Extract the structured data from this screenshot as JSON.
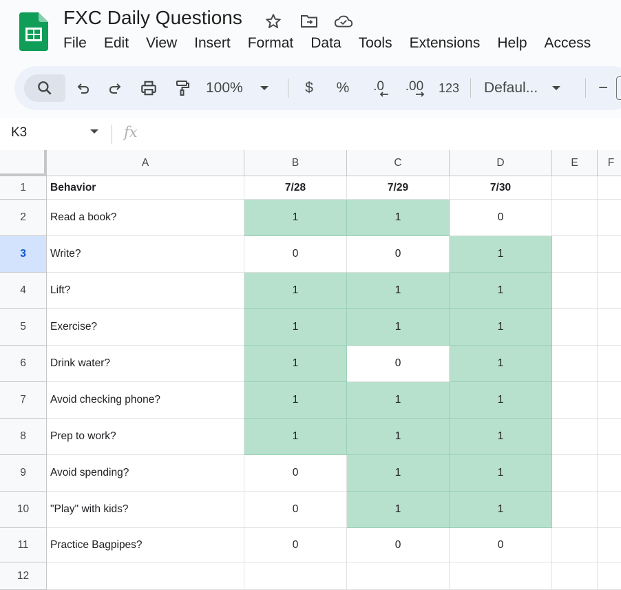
{
  "doc": {
    "title": "FXC Daily Questions",
    "icons": [
      "star-icon",
      "move-folder-icon",
      "cloud-saved-icon"
    ]
  },
  "menu": [
    "File",
    "Edit",
    "View",
    "Insert",
    "Format",
    "Data",
    "Tools",
    "Extensions",
    "Help",
    "Access"
  ],
  "toolbar": {
    "zoom": "100%",
    "currency": "$",
    "percent": "%",
    "dec_decrease": ".0",
    "dec_increase": ".00",
    "number_format": "123",
    "font": "Defaul...",
    "minus": "−"
  },
  "formula_bar": {
    "cell_ref": "K3",
    "fx": "fx"
  },
  "sheet": {
    "columns": [
      "A",
      "B",
      "C",
      "D",
      "E",
      "F"
    ],
    "rows": [
      "1",
      "2",
      "3",
      "4",
      "5",
      "6",
      "7",
      "8",
      "9",
      "10",
      "11",
      "12"
    ],
    "selected_row": "3",
    "header": [
      "Behavior",
      "7/28",
      "7/29",
      "7/30"
    ],
    "data": [
      {
        "label": "Read a book?",
        "values": [
          "1",
          "1",
          "0"
        ]
      },
      {
        "label": "Write?",
        "values": [
          "0",
          "0",
          "1"
        ]
      },
      {
        "label": "Lift?",
        "values": [
          "1",
          "1",
          "1"
        ]
      },
      {
        "label": "Exercise?",
        "values": [
          "1",
          "1",
          "1"
        ]
      },
      {
        "label": "Drink water?",
        "values": [
          "1",
          "0",
          "1"
        ]
      },
      {
        "label": "Avoid checking phone?",
        "values": [
          "1",
          "1",
          "1"
        ]
      },
      {
        "label": "Prep to work?",
        "values": [
          "1",
          "1",
          "1"
        ]
      },
      {
        "label": "Avoid spending?",
        "values": [
          "0",
          "1",
          "1"
        ]
      },
      {
        "label": "\"Play\" with kids?",
        "values": [
          "0",
          "1",
          "1"
        ]
      },
      {
        "label": "Practice Bagpipes?",
        "values": [
          "0",
          "0",
          "0"
        ]
      }
    ],
    "highlight_color": "#b7e1cd"
  }
}
